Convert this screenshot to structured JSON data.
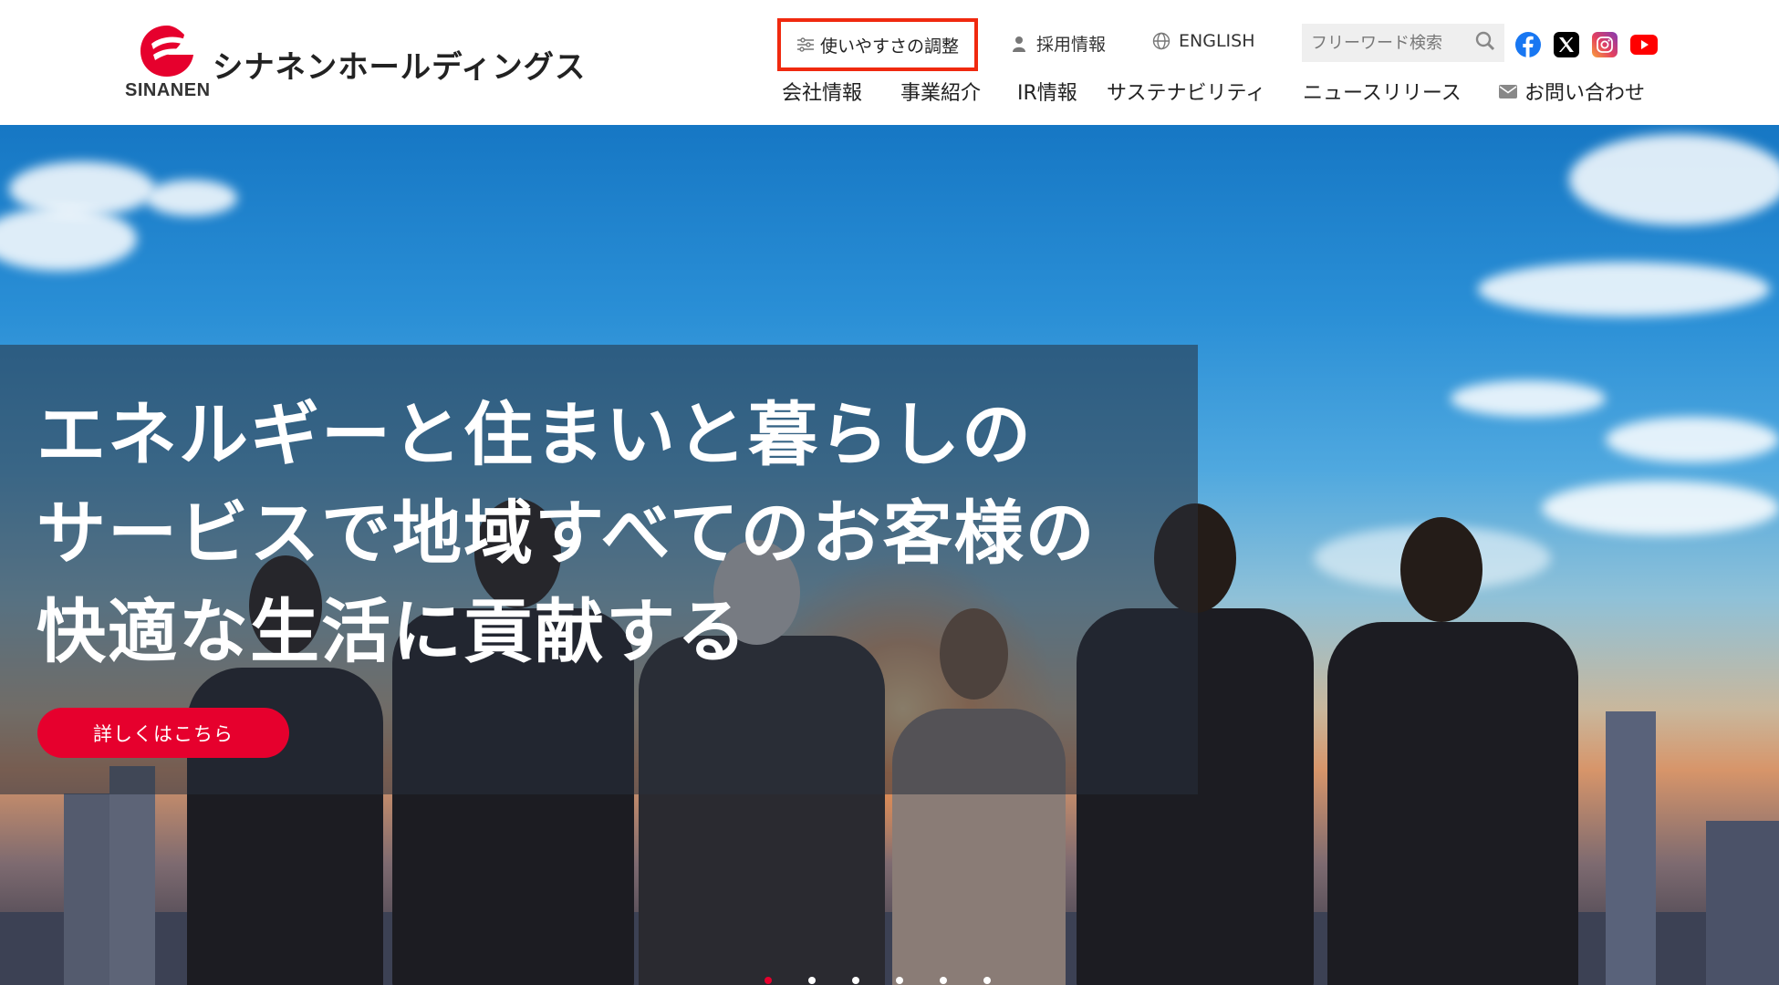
{
  "logo": {
    "en": "SINANEN",
    "jp": "シナネンホールディングス"
  },
  "util_nav": {
    "accessibility": "使いやすさの調整",
    "recruit": "採用情報",
    "english": "ENGLISH",
    "search_placeholder": "フリーワード検索"
  },
  "main_nav": {
    "items": [
      "会社情報",
      "事業紹介",
      "IR情報",
      "サステナビリティ",
      "ニュースリリース",
      "お問い合わせ"
    ]
  },
  "hero": {
    "headline_lines": [
      "エネルギーと住まいと暮らしの",
      "サービスで地域すべてのお客様の",
      "快適な生活に貢献する"
    ],
    "cta": "詳しくはこちら"
  },
  "colors": {
    "brand_red": "#e6002d",
    "highlight_red": "#f0290f"
  }
}
